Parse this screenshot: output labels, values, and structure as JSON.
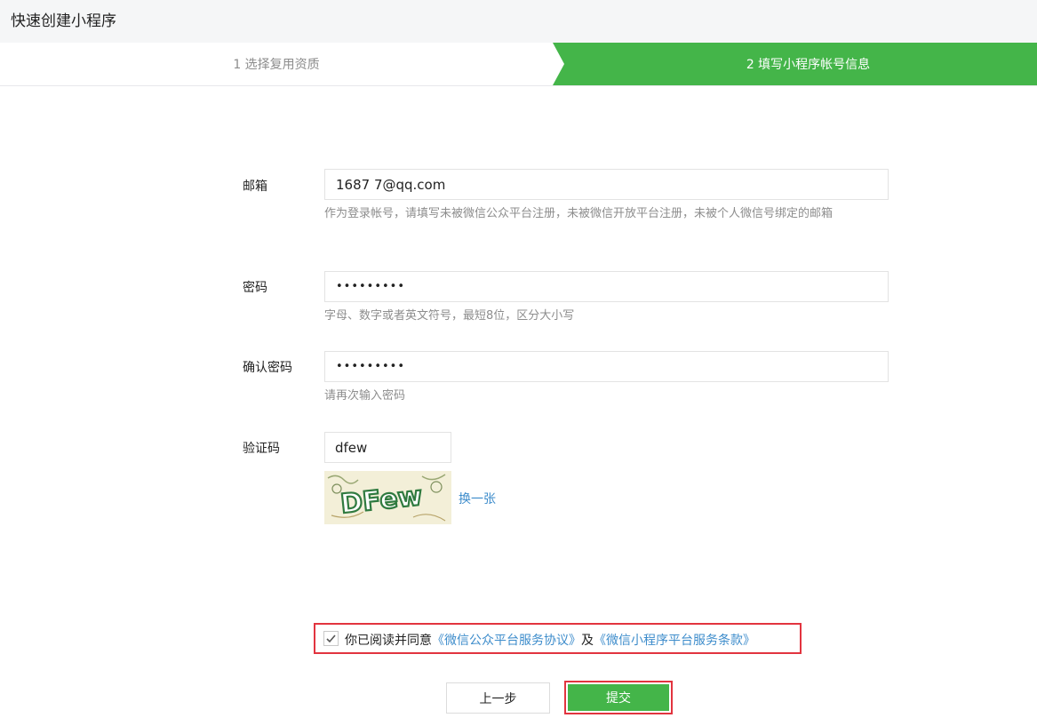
{
  "header": {
    "title": "快速创建小程序"
  },
  "steps": [
    {
      "label": "1 选择复用资质",
      "active": false
    },
    {
      "label": "2 填写小程序帐号信息",
      "active": true
    }
  ],
  "form": {
    "email": {
      "label": "邮箱",
      "value": "1687        7@qq.com",
      "hint": "作为登录帐号，请填写未被微信公众平台注册，未被微信开放平台注册，未被个人微信号绑定的邮箱"
    },
    "password": {
      "label": "密码",
      "value": "•••••••••",
      "hint": "字母、数字或者英文符号，最短8位，区分大小写"
    },
    "confirm": {
      "label": "确认密码",
      "value": "•••••••••",
      "hint": "请再次输入密码"
    },
    "captcha": {
      "label": "验证码",
      "value": "dfew",
      "image_text": "DFew",
      "refresh": "换一张"
    }
  },
  "agreement": {
    "checked": true,
    "prefix": "你已阅读并同意",
    "link1": "《微信公众平台服务协议》",
    "mid": "及",
    "link2": "《微信小程序平台服务条款》"
  },
  "buttons": {
    "prev": "上一步",
    "submit": "提交"
  },
  "colors": {
    "accent": "#44b549",
    "link": "#3d8ccb",
    "highlight": "#e2343f"
  }
}
